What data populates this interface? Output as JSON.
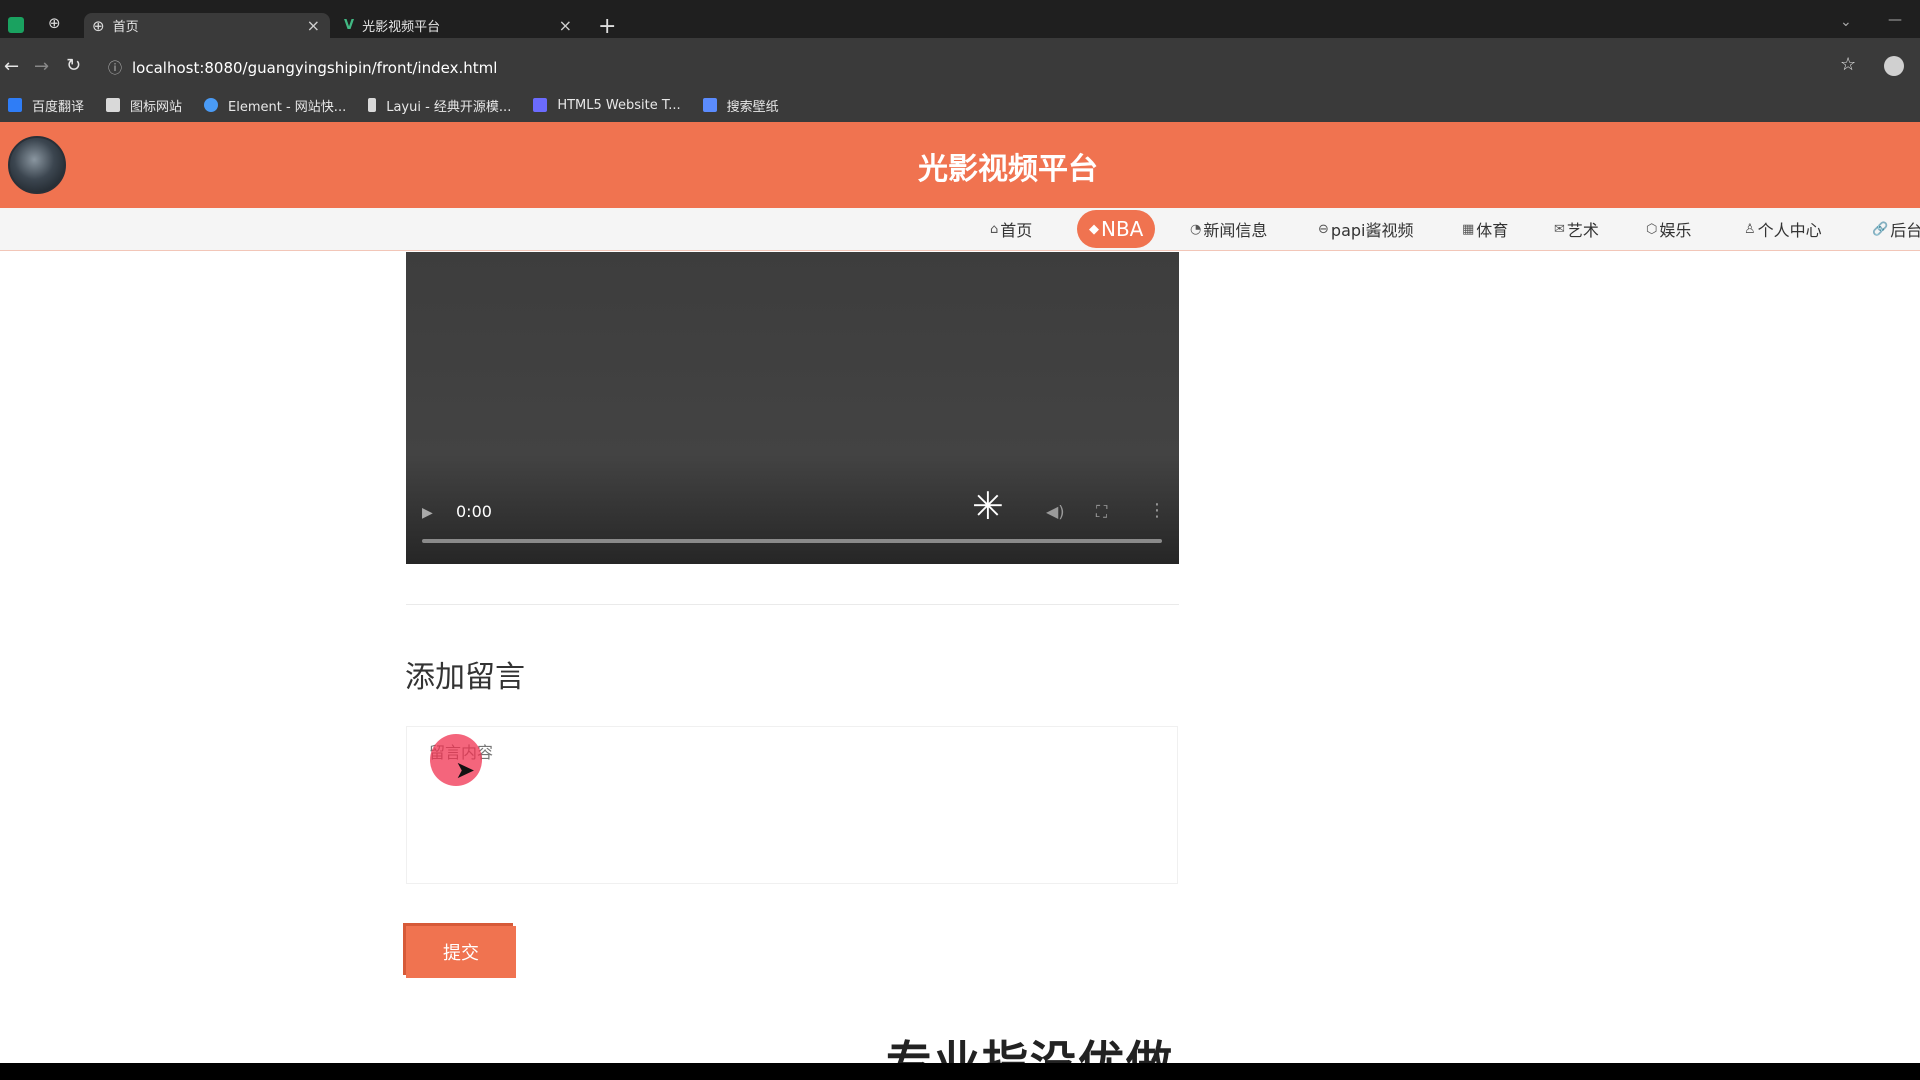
{
  "browser": {
    "tabs": [
      {
        "title": "首页",
        "active": true
      },
      {
        "title": "光影视频平台",
        "active": false
      }
    ],
    "new_tab": "+",
    "close_glyph": "×",
    "address": "localhost:8080/guangyingshipin/front/index.html",
    "bookmarks": [
      {
        "label": "百度翻译",
        "color": "#2f7df6"
      },
      {
        "label": "图标网站",
        "color": "#d9d9d9"
      },
      {
        "label": "Element - 网站快...",
        "color": "#4a9bf5"
      },
      {
        "label": "Layui - 经典开源模...",
        "color": "#d9d9d9"
      },
      {
        "label": "HTML5 Website T...",
        "color": "#6b6bff"
      },
      {
        "label": "搜索壁纸",
        "color": "#5b8cff"
      }
    ]
  },
  "site": {
    "title": "光影视频平台",
    "accent_color": "#f07350",
    "nav": [
      {
        "label": "首页",
        "icon": "⌂"
      },
      {
        "label": "NBA",
        "icon": "◆",
        "active": true
      },
      {
        "label": "新闻信息",
        "icon": "◔"
      },
      {
        "label": "papi酱视频",
        "icon": "⊖"
      },
      {
        "label": "体育",
        "icon": "▦"
      },
      {
        "label": "艺术",
        "icon": "✉"
      },
      {
        "label": "娱乐",
        "icon": "⬡"
      },
      {
        "label": "个人中心",
        "icon": "♙"
      },
      {
        "label": "后台",
        "icon": "🔗"
      }
    ]
  },
  "video": {
    "time": "0:00"
  },
  "comment": {
    "section_title": "添加留言",
    "placeholder": "留言内容",
    "submit_label": "提交"
  },
  "footer": {
    "heading": "专业指没优做"
  }
}
